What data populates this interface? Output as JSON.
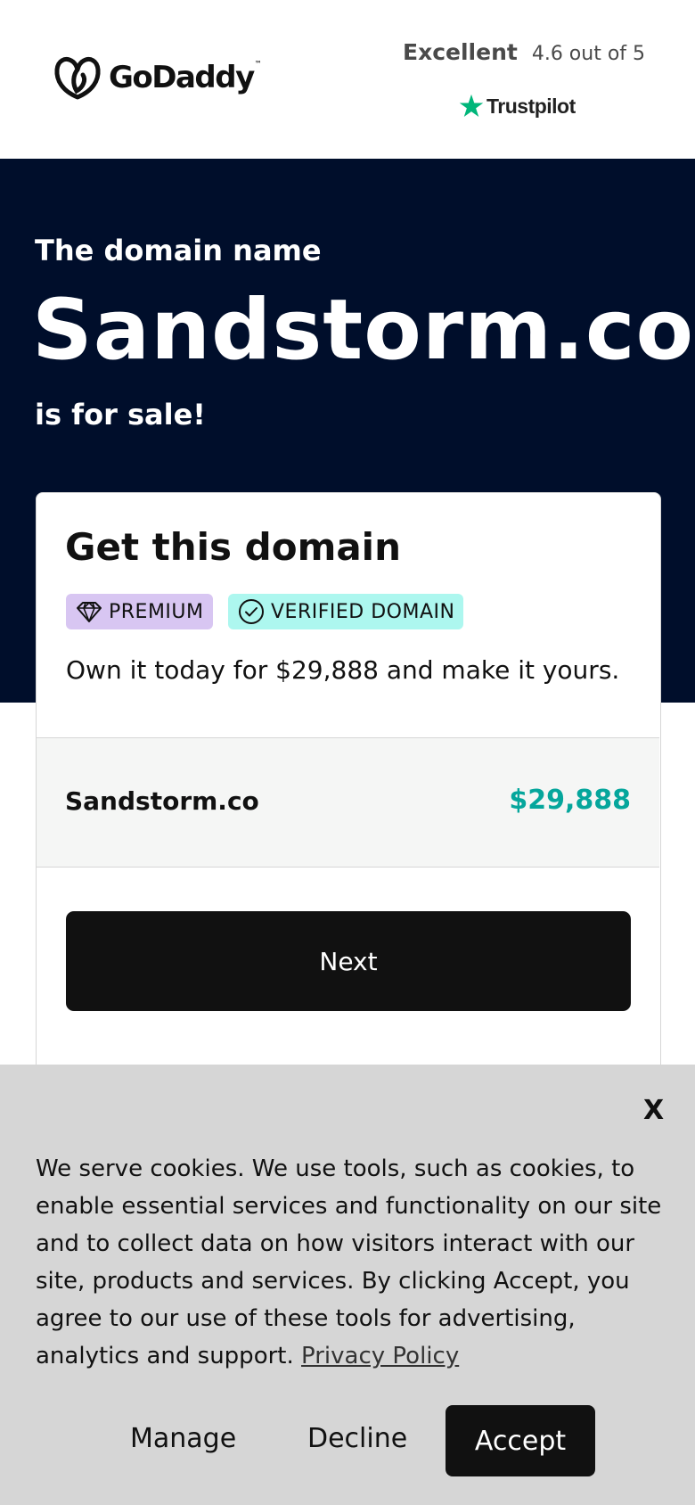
{
  "header": {
    "brand": "GoDaddy",
    "brand_tm": "™",
    "rating_label": "Excellent",
    "rating_score": "4.6 out of 5",
    "trustpilot_label": "Trustpilot",
    "trustpilot_color": "#00b67a"
  },
  "hero": {
    "intro": "The domain name",
    "domain": "Sandstorm.co",
    "outro": "is for sale!",
    "background": "#000e2b"
  },
  "card": {
    "title": "Get this domain",
    "badge_premium": "PREMIUM",
    "badge_verified": "VERIFIED DOMAIN",
    "description": "Own it today for $29,888 and make it yours.",
    "price_domain": "Sandstorm.co",
    "price_value": "$29,888",
    "price_color": "#05a69c",
    "next_label": "Next"
  },
  "cookie": {
    "close_label": "X",
    "text": "We serve cookies. We use tools, such as cookies, to enable essential services and functionality on our site and to collect data on how visitors interact with our site, products and services. By clicking Accept, you agree to our use of these tools for advertising, analytics and support. ",
    "privacy_link": "Privacy Policy",
    "manage_label": "Manage",
    "decline_label": "Decline",
    "accept_label": "Accept"
  }
}
